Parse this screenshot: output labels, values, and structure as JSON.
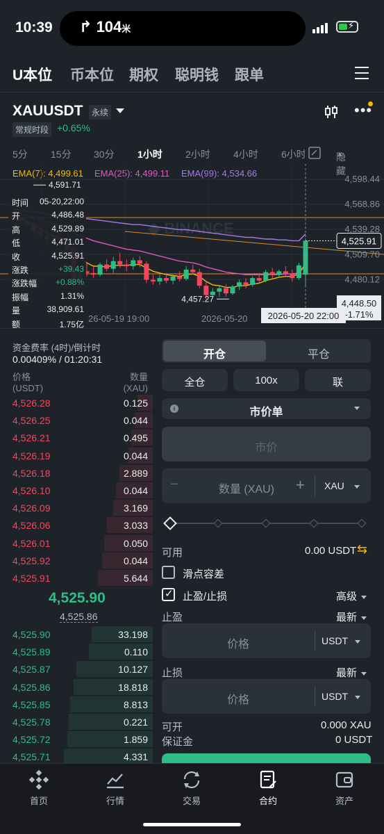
{
  "status_bar": {
    "time": "10:39",
    "nav_distance": "104",
    "nav_unit": "米"
  },
  "top_tabs": [
    "U本位",
    "币本位",
    "期权",
    "聪明钱",
    "跟单"
  ],
  "pair": {
    "symbol": "XAUUSDT",
    "type": "永续",
    "session": "常规时段",
    "change": "+0.65%"
  },
  "intervals": [
    "5分",
    "15分",
    "30分",
    "1小时",
    "2小时",
    "4小时",
    "6小时"
  ],
  "active_interval": "1小时",
  "hide_label": "隐藏",
  "ema": {
    "ema7": "EMA(7): 4,499.61",
    "ema25": "EMA(25): 4,499.11",
    "ema99": "EMA(99): 4,534.66"
  },
  "chart_data": {
    "type": "candlestick",
    "watermark": "BINANCE",
    "price_axis": [
      "4,598.44",
      "4,568.86",
      "4,539.28",
      "4,509.70",
      "4,480.12"
    ],
    "ylim": [
      4448.5,
      4598.44
    ],
    "current_price": "4,525.91",
    "crosshair_price": "4,448.50",
    "crosshair_change": "-1.71%",
    "crosshair_time": "2026-05-20 22:00",
    "x_labels": [
      "26-05-19 19:00",
      "2026-05-20"
    ],
    "high_marker": "4,591.71",
    "low_marker": "4,457.27",
    "candles": [
      [
        4556,
        4563,
        4548,
        4552
      ],
      [
        4552,
        4560,
        4545,
        4549
      ],
      [
        4549,
        4557,
        4541,
        4545
      ],
      [
        4545,
        4552,
        4534,
        4538
      ],
      [
        4538,
        4545,
        4528,
        4532
      ],
      [
        4532,
        4540,
        4522,
        4528
      ],
      [
        4528,
        4537,
        4520,
        4530
      ],
      [
        4530,
        4538,
        4520,
        4524
      ],
      [
        4524,
        4530,
        4512,
        4516
      ],
      [
        4516,
        4520,
        4468,
        4478
      ],
      [
        4478,
        4496,
        4470,
        4490
      ],
      [
        4490,
        4500,
        4484,
        4488
      ],
      [
        4488,
        4495,
        4482,
        4486
      ],
      [
        4486,
        4500,
        4484,
        4498
      ],
      [
        4498,
        4504,
        4490,
        4493
      ],
      [
        4493,
        4507,
        4488,
        4502
      ],
      [
        4502,
        4512,
        4494,
        4498
      ],
      [
        4498,
        4504,
        4490,
        4496
      ],
      [
        4496,
        4506,
        4492,
        4503
      ],
      [
        4503,
        4508,
        4495,
        4499
      ],
      [
        4499,
        4502,
        4476,
        4480
      ],
      [
        4480,
        4486,
        4474,
        4478
      ],
      [
        4478,
        4486,
        4474,
        4482
      ],
      [
        4482,
        4488,
        4476,
        4479
      ],
      [
        4479,
        4486,
        4475,
        4484
      ],
      [
        4484,
        4490,
        4478,
        4481
      ],
      [
        4481,
        4496,
        4479,
        4492
      ],
      [
        4492,
        4498,
        4486,
        4489
      ],
      [
        4489,
        4493,
        4470,
        4473
      ],
      [
        4473,
        4478,
        4457,
        4462
      ],
      [
        4462,
        4470,
        4458,
        4466
      ],
      [
        4466,
        4474,
        4460,
        4470
      ],
      [
        4470,
        4475,
        4460,
        4464
      ],
      [
        4464,
        4474,
        4462,
        4472
      ],
      [
        4472,
        4480,
        4468,
        4477
      ],
      [
        4477,
        4482,
        4470,
        4474
      ],
      [
        4474,
        4484,
        4472,
        4482
      ],
      [
        4482,
        4488,
        4476,
        4479
      ],
      [
        4479,
        4492,
        4477,
        4489
      ],
      [
        4489,
        4494,
        4482,
        4486
      ],
      [
        4486,
        4492,
        4482,
        4490
      ],
      [
        4490,
        4496,
        4484,
        4487
      ],
      [
        4487,
        4492,
        4478,
        4482
      ],
      [
        4482,
        4500,
        4480,
        4497
      ],
      [
        4486,
        4529,
        4471,
        4526
      ]
    ],
    "ema7": [
      4556,
      4553,
      4549,
      4545,
      4540,
      4535,
      4532,
      4529,
      4525,
      4512,
      4505,
      4500,
      4496,
      4496,
      4495,
      4497,
      4497,
      4497,
      4498,
      4498,
      4494,
      4490,
      4488,
      4486,
      4485,
      4484,
      4486,
      4487,
      4484,
      4478,
      4474,
      4473,
      4471,
      4471,
      4473,
      4473,
      4475,
      4476,
      4479,
      4481,
      4483,
      4484,
      4484,
      4487,
      4499
    ],
    "ema25": [
      4560,
      4558,
      4556,
      4554,
      4551,
      4548,
      4546,
      4543,
      4540,
      4536,
      4532,
      4529,
      4526,
      4524,
      4522,
      4520,
      4518,
      4516,
      4515,
      4514,
      4512,
      4510,
      4508,
      4506,
      4504,
      4502,
      4501,
      4500,
      4498,
      4495,
      4493,
      4491,
      4489,
      4488,
      4487,
      4486,
      4486,
      4486,
      4486,
      4486,
      4486,
      4487,
      4487,
      4488,
      4499
    ],
    "ema99": [
      4563,
      4562,
      4561,
      4560,
      4559,
      4558,
      4557,
      4556,
      4555,
      4554,
      4553,
      4552,
      4551,
      4550,
      4549,
      4548,
      4547,
      4546,
      4545,
      4545,
      4544,
      4543,
      4542,
      4541,
      4540,
      4539,
      4539,
      4538,
      4537,
      4536,
      4535,
      4534,
      4533,
      4532,
      4531,
      4530,
      4530,
      4529,
      4528,
      4528,
      4527,
      4527,
      4526,
      4526,
      4534
    ]
  },
  "candle_info": [
    [
      "时间",
      "05-20,22:00"
    ],
    [
      "开",
      "4,486.48"
    ],
    [
      "高",
      "4,529.89"
    ],
    [
      "低",
      "4,471.01"
    ],
    [
      "收",
      "4,525.91"
    ],
    [
      "涨跌",
      "+39.43"
    ],
    [
      "涨跌幅",
      "+0.88%"
    ],
    [
      "振幅",
      "1.31%"
    ],
    [
      "量",
      "38,909.61"
    ],
    [
      "额",
      "1.75亿"
    ]
  ],
  "funding": {
    "label": "资金费率 (4时)/倒计时",
    "value": "0.00409% / 01:20:31"
  },
  "orderbook": {
    "price_header": "价格",
    "price_unit": "(USDT)",
    "qty_header": "数量",
    "qty_unit": "(XAU)",
    "asks": [
      [
        "4,526.28",
        "0.125",
        0.1
      ],
      [
        "4,526.25",
        "0.044",
        0.12
      ],
      [
        "4,526.21",
        "0.495",
        0.14
      ],
      [
        "4,526.19",
        "0.044",
        0.16
      ],
      [
        "4,526.18",
        "2.889",
        0.22
      ],
      [
        "4,526.10",
        "0.044",
        0.24
      ],
      [
        "4,526.09",
        "3.169",
        0.26
      ],
      [
        "4,526.06",
        "3.033",
        0.3
      ],
      [
        "4,526.01",
        "0.050",
        0.32
      ],
      [
        "4,525.92",
        "0.044",
        0.33
      ],
      [
        "4,525.91",
        "5.644",
        0.36
      ]
    ],
    "mid_price": "4,525.90",
    "mark_price": "4,525.86",
    "bids": [
      [
        "4,525.90",
        "33.198",
        0.4
      ],
      [
        "4,525.89",
        "0.110",
        0.42
      ],
      [
        "4,525.87",
        "10.127",
        0.5
      ],
      [
        "4,525.86",
        "18.818",
        0.52
      ],
      [
        "4,525.85",
        "8.813",
        0.54
      ],
      [
        "4,525.78",
        "0.221",
        0.55
      ],
      [
        "4,525.72",
        "1.859",
        0.56
      ],
      [
        "4,525.71",
        "4.331",
        0.58
      ]
    ]
  },
  "form": {
    "open_tab": "开仓",
    "close_tab": "平仓",
    "margin_mode": "全仓",
    "leverage": "100x",
    "position_mode": "联",
    "order_type": "市价单",
    "market_price": "市价",
    "qty_placeholder": "数量 (XAU)",
    "qty_unit": "XAU",
    "available_label": "可用",
    "available_value": "0.00 USDT",
    "slippage_label": "滑点容差",
    "tpsl_label": "止盈/止损",
    "advanced": "高级",
    "tp_label": "止盈",
    "sl_label": "止损",
    "latest": "最新",
    "price_placeholder": "价格",
    "price_unit": "USDT",
    "can_open_label": "可开",
    "can_open_value": "0.000 XAU",
    "margin_label": "保证金",
    "margin_value": "0 USDT"
  },
  "bottom_nav": [
    "首页",
    "行情",
    "交易",
    "合约",
    "资产"
  ],
  "active_bottom": "合约"
}
